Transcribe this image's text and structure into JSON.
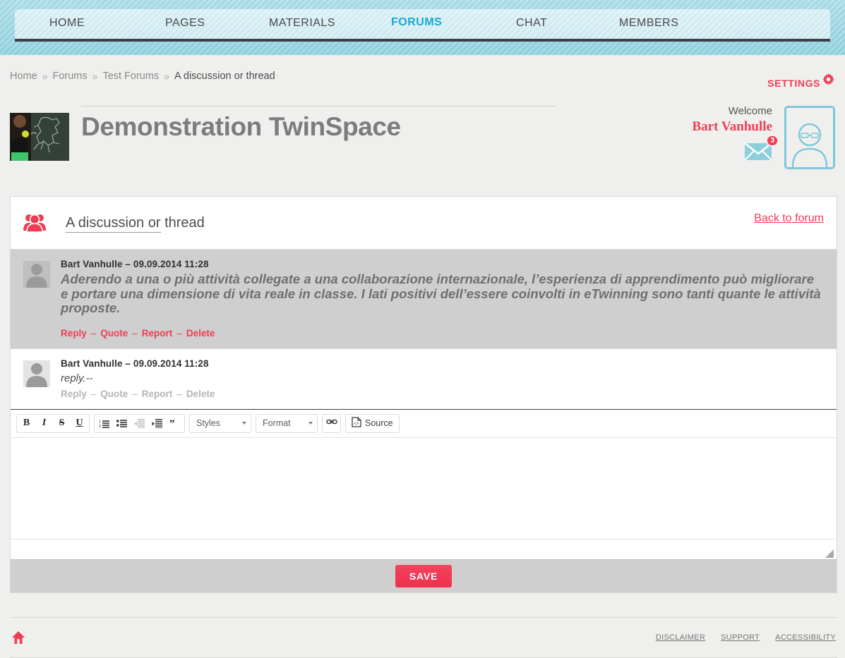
{
  "nav": {
    "items": [
      {
        "label": "HOME",
        "active": false
      },
      {
        "label": "PAGES",
        "active": false
      },
      {
        "label": "MATERIALS",
        "active": false
      },
      {
        "label": "FORUMS",
        "active": true
      },
      {
        "label": "CHAT",
        "active": false
      },
      {
        "label": "MEMBERS",
        "active": false
      }
    ]
  },
  "breadcrumb": {
    "separator": "»",
    "items": [
      "Home",
      "Forums",
      "Test Forums",
      "A discussion or thread"
    ]
  },
  "settings": {
    "label": "SETTINGS",
    "icon": "gear-icon"
  },
  "header": {
    "site_title": "Demonstration TwinSpace",
    "thumbnail_alt": "twinspace-thumbnail"
  },
  "user": {
    "welcome_label": "Welcome",
    "name": "Bart Vanhulle",
    "messages_count": "3",
    "mail_icon": "mail-icon",
    "avatar_icon": "user-avatar-icon"
  },
  "thread": {
    "icon": "group-icon",
    "title_underlined": "A discussion or",
    "title_rest": " thread",
    "back_link": "Back to forum"
  },
  "posts": [
    {
      "author": "Bart Vanhulle",
      "separator": "–",
      "timestamp": "09.09.2014 11:28",
      "text": "Aderendo a una o più attività collegate a una collaborazione internazionale, l’esperienza di apprendimento può migliorare e portare una dimensione di vita reale in classe. I lati positivi dell’essere coinvolti in eTwinning sono tanti quante le attività proposte.",
      "actions": [
        "Reply",
        "Quote",
        "Report",
        "Delete"
      ]
    },
    {
      "author": "Bart Vanhulle",
      "separator": "–",
      "timestamp": "09.09.2014 11:28",
      "text": "reply.--",
      "actions": [
        "Reply",
        "Quote",
        "Report",
        "Delete"
      ]
    }
  ],
  "editor": {
    "buttons": [
      {
        "name": "bold-button",
        "label": "B",
        "style": "b",
        "disabled": false
      },
      {
        "name": "italic-button",
        "label": "I",
        "style": "i",
        "disabled": false
      },
      {
        "name": "strikethrough-button",
        "label": "S",
        "style": "s",
        "disabled": false
      },
      {
        "name": "underline-button",
        "label": "U",
        "style": "u",
        "disabled": false
      }
    ],
    "list_buttons": [
      {
        "name": "numbered-list-button",
        "icon": "numbered-list-icon",
        "disabled": false
      },
      {
        "name": "bulleted-list-button",
        "icon": "bulleted-list-icon",
        "disabled": false
      },
      {
        "name": "decrease-indent-button",
        "icon": "decrease-indent-icon",
        "disabled": true
      },
      {
        "name": "increase-indent-button",
        "icon": "increase-indent-icon",
        "disabled": false
      },
      {
        "name": "blockquote-button",
        "icon": "quote-icon",
        "disabled": false
      }
    ],
    "styles_select": "Styles",
    "format_select": "Format",
    "link_button": "link-icon",
    "source_button": "Source",
    "content": "",
    "resize_handle": "resize-handle"
  },
  "save": {
    "label": "SAVE"
  },
  "footer": {
    "home_icon": "home-icon",
    "links": [
      "DISCLAIMER",
      "SUPPORT",
      "ACCESSIBILITY"
    ]
  },
  "colors": {
    "accent_red": "#ee3d52",
    "nav_active": "#14a9d5",
    "topbar": "#a9dbe6",
    "page_bg": "#efefed",
    "post_bg": "#cfcfcf"
  }
}
